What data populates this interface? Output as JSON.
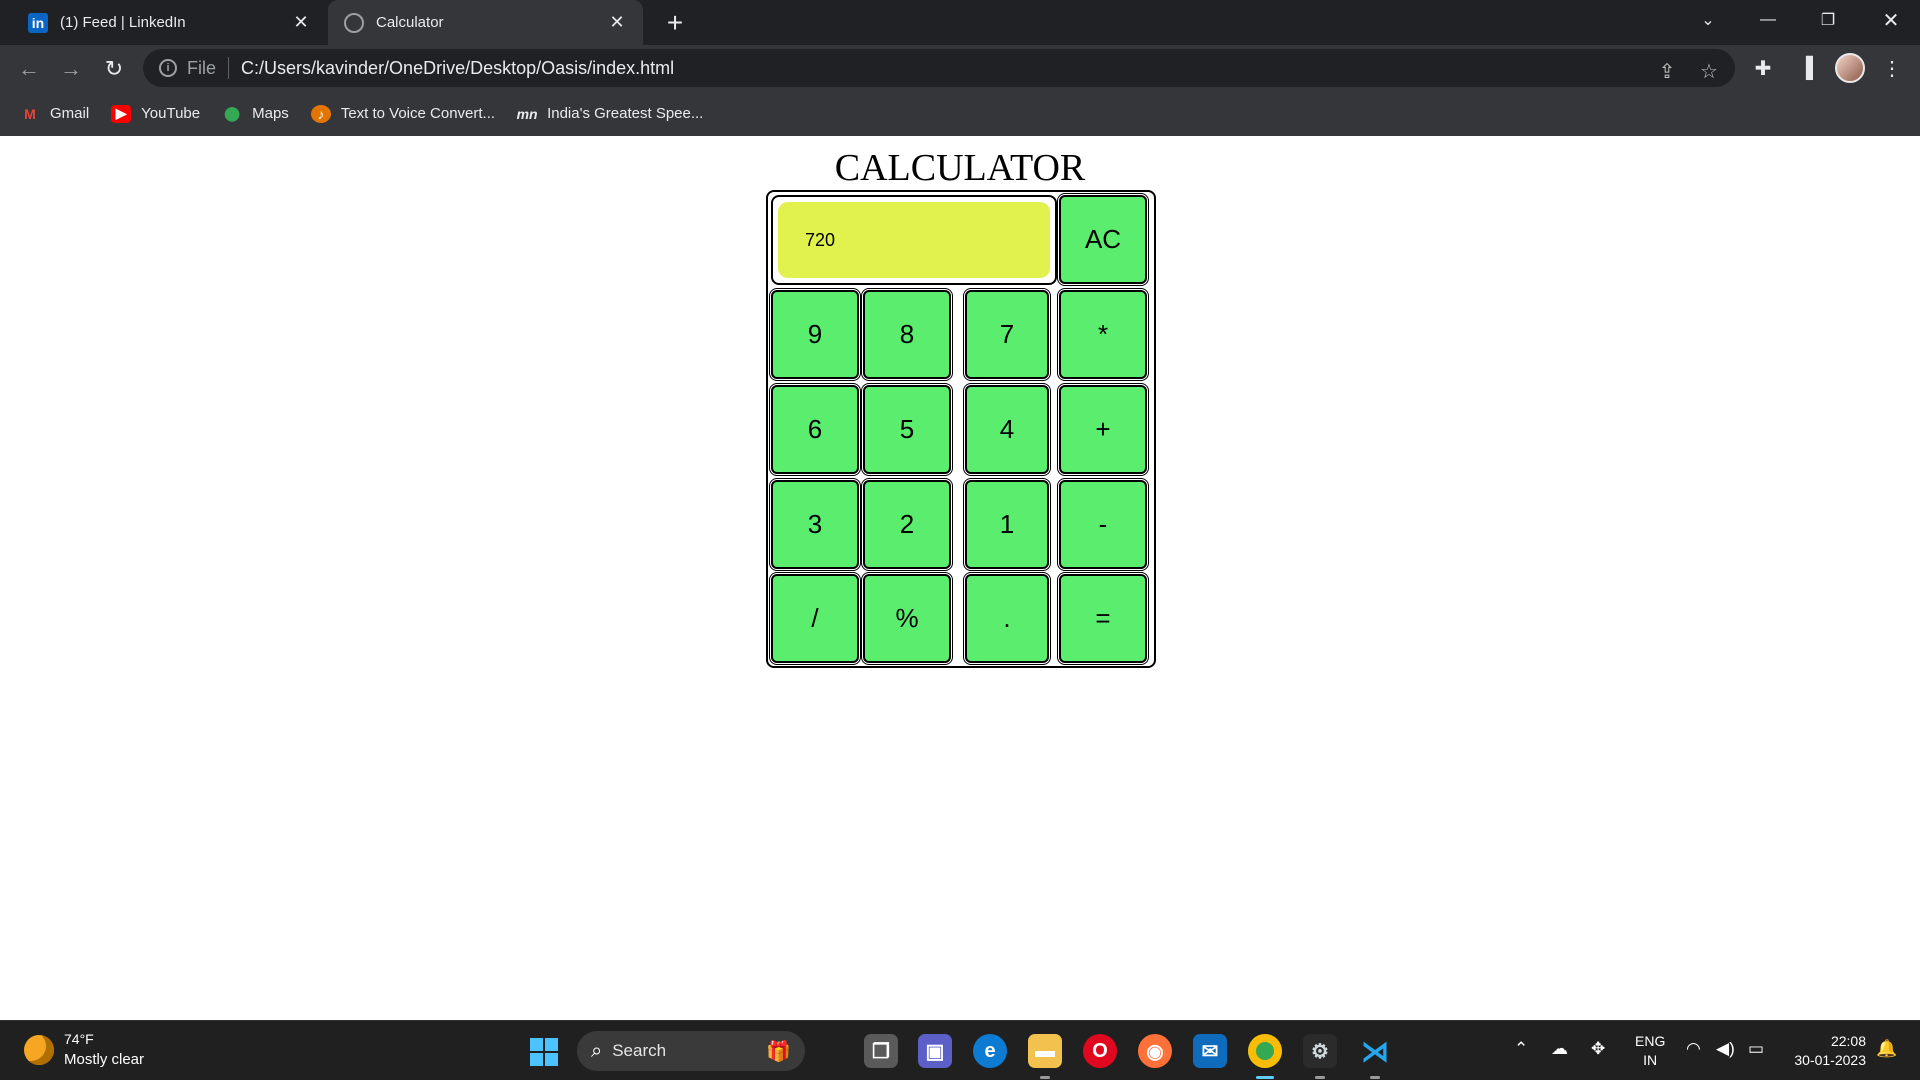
{
  "browser": {
    "tabs": [
      {
        "title": "(1) Feed | LinkedIn",
        "favicon": "linkedin-icon",
        "favicon_text": "in"
      },
      {
        "title": "Calculator",
        "favicon": "globe-icon"
      }
    ],
    "address": {
      "scheme": "File",
      "url": "C:/Users/kavinder/OneDrive/Desktop/Oasis/index.html"
    },
    "bookmarks": [
      {
        "label": "Gmail",
        "icon": "gmail-icon",
        "glyph": "M"
      },
      {
        "label": "YouTube",
        "icon": "youtube-icon",
        "glyph": "▶"
      },
      {
        "label": "Maps",
        "icon": "maps-icon",
        "glyph": "⬤"
      },
      {
        "label": "Text to Voice Convert...",
        "icon": "text-to-voice-icon",
        "glyph": "♪"
      },
      {
        "label": "India's Greatest Spee...",
        "icon": "mn-icon",
        "glyph": "mn"
      }
    ]
  },
  "calculator": {
    "title": "CALCULATOR",
    "display_value": "720",
    "clear_label": "AC",
    "keys": {
      "k9": "9",
      "k8": "8",
      "k7": "7",
      "multiply": "*",
      "k6": "6",
      "k5": "5",
      "k4": "4",
      "plus": "+",
      "k3": "3",
      "k2": "2",
      "k1": "1",
      "minus": "-",
      "divide": "/",
      "percent": "%",
      "decimal": ".",
      "equals": "="
    },
    "colors": {
      "display": "#e1f24f",
      "keys": "#5aed6e"
    }
  },
  "taskbar": {
    "weather": {
      "temp": "74°F",
      "desc": "Mostly clear"
    },
    "search_label": "Search",
    "language": {
      "line1": "ENG",
      "line2": "IN"
    },
    "clock": {
      "time": "22:08",
      "date": "30-01-2023"
    }
  }
}
